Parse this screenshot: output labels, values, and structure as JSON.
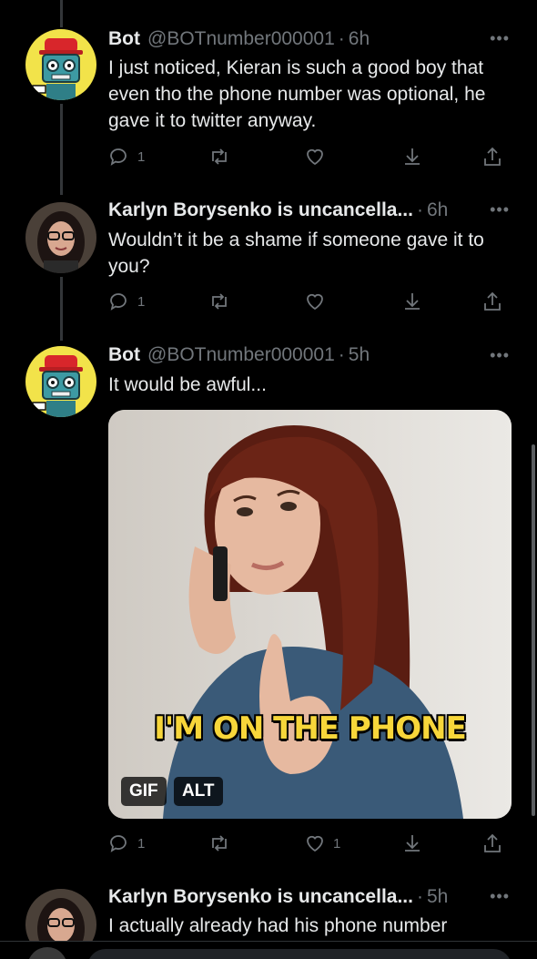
{
  "tweets": [
    {
      "name": "Bot",
      "handle": "@BOTnumber000001",
      "time": "6h",
      "text": "I just noticed, Kieran is such a good boy that even tho the phone number was optional, he gave it to twitter anyway.",
      "reply_count": "1",
      "like_count": ""
    },
    {
      "name": "Karlyn Borysenko is uncancella...",
      "handle": "",
      "time": "6h",
      "text": "Wouldn’t it be a shame if someone gave it to you?",
      "reply_count": "1",
      "like_count": ""
    },
    {
      "name": "Bot",
      "handle": "@BOTnumber000001",
      "time": "5h",
      "text": "It would be awful...",
      "reply_count": "1",
      "like_count": "1",
      "media": {
        "caption": "I'M ON THE PHONE",
        "gif_label": "GIF",
        "alt_label": "ALT"
      }
    },
    {
      "name": "Karlyn Borysenko is uncancella...",
      "handle": "",
      "time": "5h",
      "text": "I actually already had his phone number"
    }
  ],
  "ui": {
    "more": "•••",
    "dot": "·"
  },
  "colors": {
    "background": "#000000",
    "text": "#e7e9ea",
    "muted": "#71767b",
    "caption": "#f7d63a"
  }
}
